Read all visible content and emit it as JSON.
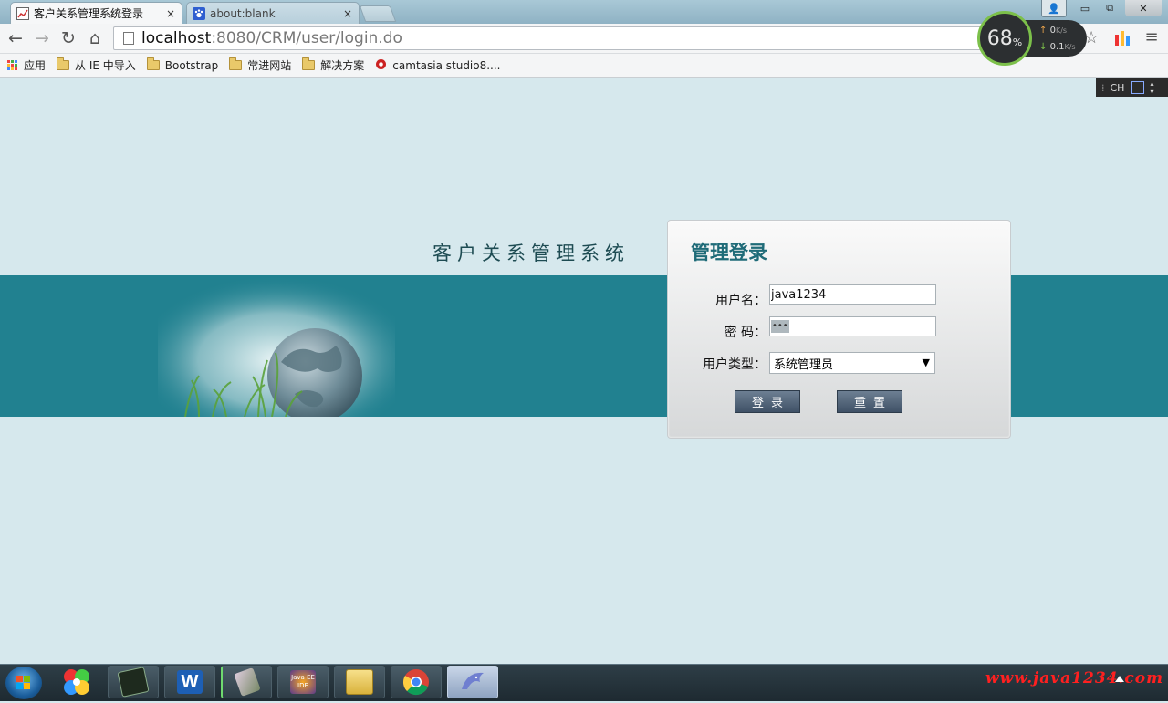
{
  "browser": {
    "tabs": [
      {
        "title": "客户关系管理系统登录",
        "active": true,
        "close": "×"
      },
      {
        "title": "about:blank",
        "active": false,
        "close": "×"
      }
    ],
    "url_host": "localhost",
    "url_rest": ":8080/CRM/user/login.do",
    "window_buttons": {
      "user": "👤",
      "minimize": "▭",
      "maximize": "⧉",
      "close": "✕"
    },
    "nav": {
      "back": "←",
      "forward": "→",
      "reload": "↻",
      "home": "⌂"
    },
    "star": "☆",
    "menu": "≡"
  },
  "bookmarks": [
    {
      "label": "应用",
      "icon": "apps-grid-icon"
    },
    {
      "label": "从 IE 中导入",
      "icon": "folder-icon"
    },
    {
      "label": "Bootstrap",
      "icon": "folder-icon"
    },
    {
      "label": "常进网站",
      "icon": "folder-icon"
    },
    {
      "label": "解决方案",
      "icon": "folder-icon"
    },
    {
      "label": "camtasia studio8....",
      "icon": "camtasia-icon"
    }
  ],
  "speed_widget": {
    "percent": "68",
    "percent_sign": "%",
    "up": "0",
    "up_unit": "K/s",
    "down": "0.1",
    "down_unit": "K/s"
  },
  "ime": {
    "label": "CH"
  },
  "page": {
    "system_title": "客户关系管理系统",
    "panel_title": "管理登录",
    "username_label": "用户名：",
    "password_label": "密 码：",
    "usertype_label": "用户类型：",
    "username_value": "java1234",
    "password_mask": "•••",
    "usertype_selected": "系统管理员",
    "select_arrow": "▼",
    "login_button": "登录",
    "reset_button": "重置"
  },
  "taskbar": {
    "watermark": "www.java1234.com",
    "apps": [
      "windows-start-icon",
      "pinwheel-app-icon",
      "console-app-icon",
      "word-icon",
      "app-icon",
      "java-ee-ide-icon",
      "file-explorer-icon",
      "chrome-icon",
      "dolphin-app-icon"
    ],
    "java_ee_label": "Java EE IDE"
  },
  "colors": {
    "band": "#218190",
    "background": "#d6e8ed",
    "panel_title": "#1f6b78",
    "button": "#4f6176",
    "watermark": "#ff2020"
  }
}
